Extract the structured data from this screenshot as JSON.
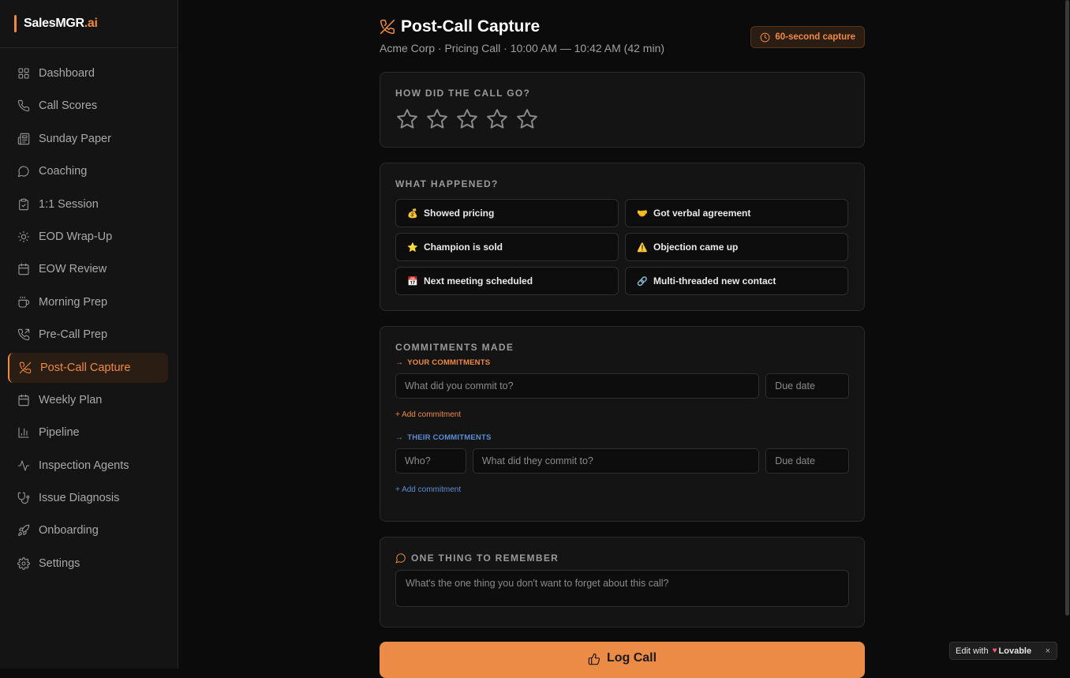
{
  "brand": {
    "name": "SalesMGR",
    "suffix": ".ai"
  },
  "sidebar": {
    "items": [
      {
        "label": "Dashboard",
        "icon": "grid-icon"
      },
      {
        "label": "Call Scores",
        "icon": "phone-icon"
      },
      {
        "label": "Sunday Paper",
        "icon": "newspaper-icon"
      },
      {
        "label": "Coaching",
        "icon": "message-circle-icon"
      },
      {
        "label": "1:1 Session",
        "icon": "clipboard-icon"
      },
      {
        "label": "EOD Wrap-Up",
        "icon": "sun-icon"
      },
      {
        "label": "EOW Review",
        "icon": "calendar-icon"
      },
      {
        "label": "Morning Prep",
        "icon": "coffee-icon"
      },
      {
        "label": "Pre-Call Prep",
        "icon": "phone-outgoing-icon"
      },
      {
        "label": "Post-Call Capture",
        "icon": "phone-off-icon",
        "active": true
      },
      {
        "label": "Weekly Plan",
        "icon": "calendar-icon"
      },
      {
        "label": "Pipeline",
        "icon": "bar-chart-icon"
      },
      {
        "label": "Inspection Agents",
        "icon": "activity-icon"
      },
      {
        "label": "Issue Diagnosis",
        "icon": "stethoscope-icon"
      },
      {
        "label": "Onboarding",
        "icon": "rocket-icon"
      },
      {
        "label": "Settings",
        "icon": "gear-icon"
      }
    ]
  },
  "header": {
    "title": "Post-Call Capture",
    "subtitle": "Acme Corp · Pricing Call · 10:00 AM — 10:42 AM (42 min)",
    "badge": "60-second capture"
  },
  "rating": {
    "label": "How did the call go?",
    "value": 0,
    "max": 5
  },
  "happened": {
    "label": "What happened?",
    "options": [
      {
        "emoji": "💰",
        "label": "Showed pricing"
      },
      {
        "emoji": "🤝",
        "label": "Got verbal agreement"
      },
      {
        "emoji": "⭐",
        "label": "Champion is sold"
      },
      {
        "emoji": "⚠️",
        "label": "Objection came up"
      },
      {
        "emoji": "📅",
        "label": "Next meeting scheduled"
      },
      {
        "emoji": "🔗",
        "label": "Multi-threaded new contact"
      }
    ]
  },
  "commitments": {
    "label": "Commitments made",
    "yours": {
      "label": "Your commitments",
      "commit_placeholder": "What did you commit to?",
      "date_placeholder": "Due date",
      "add": "+ Add commitment"
    },
    "theirs": {
      "label": "Their commitments",
      "who_placeholder": "Who?",
      "commit_placeholder": "What did they commit to?",
      "date_placeholder": "Due date",
      "add": "+ Add commitment"
    }
  },
  "remember": {
    "label": "One thing to remember",
    "placeholder": "What's the one thing you don't want to forget about this call?"
  },
  "submit": {
    "label": "Log Call"
  },
  "lovable": {
    "prefix": "Edit with",
    "name": "Lovable",
    "close": "×"
  },
  "colors": {
    "accent": "#f08a3c",
    "blue": "#5b8ed6",
    "background": "#0b0b0b",
    "card": "#141414"
  }
}
